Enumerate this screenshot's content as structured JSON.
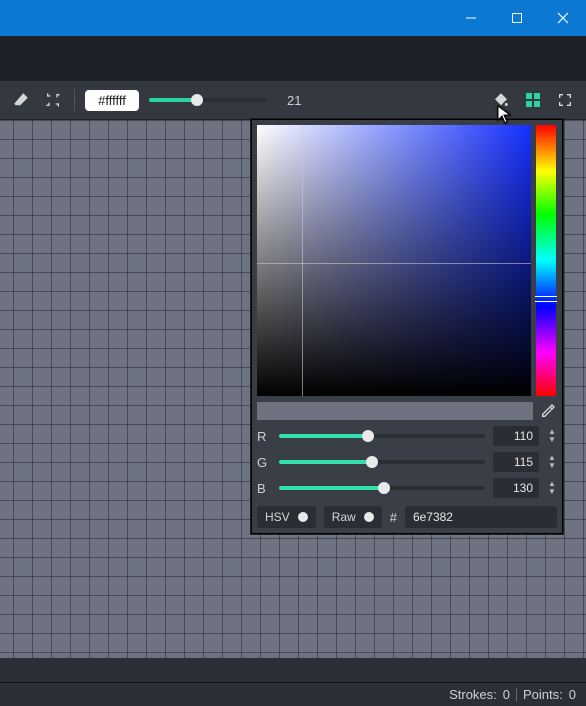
{
  "toolbar": {
    "hex": "#ffffff",
    "brush_value": "21"
  },
  "picker": {
    "channels": {
      "r": {
        "label": "R",
        "value": "110",
        "pct": 43
      },
      "g": {
        "label": "G",
        "value": "115",
        "pct": 45
      },
      "b": {
        "label": "B",
        "value": "130",
        "pct": 51
      }
    },
    "hsv_toggle_label": "HSV",
    "raw_toggle_label": "Raw",
    "hash": "#",
    "hex": "6e7382",
    "preview_color": "#6e7382"
  },
  "status": {
    "strokes_label": "Strokes:",
    "strokes_value": "0",
    "points_label": "Points:",
    "points_value": "0"
  }
}
